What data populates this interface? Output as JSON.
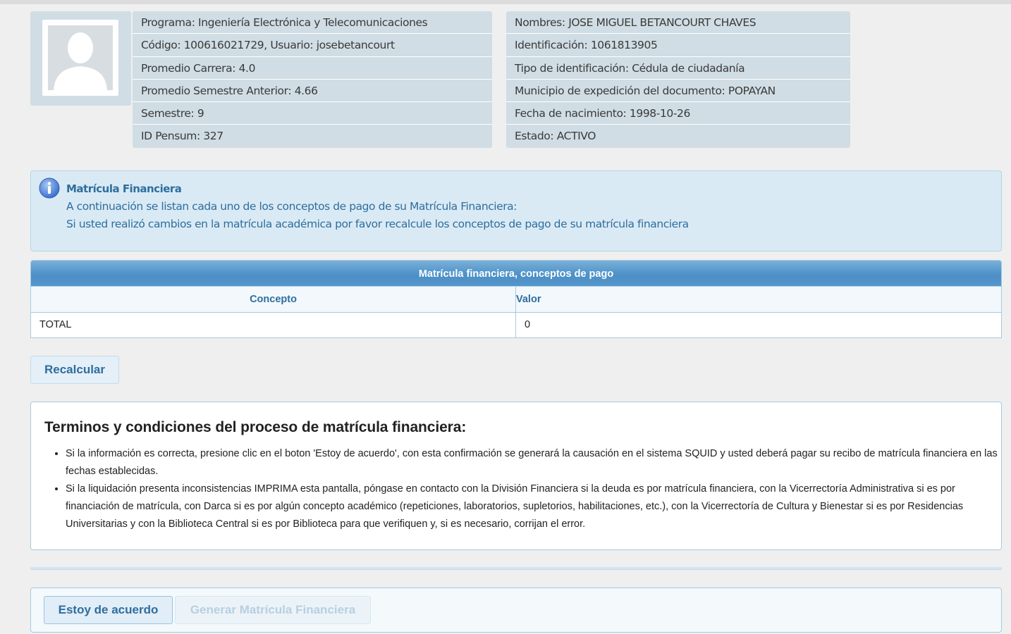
{
  "profile": {
    "left": [
      "Programa: Ingeniería Electrónica y Telecomunicaciones",
      "Código: 100616021729, Usuario: josebetancourt",
      "Promedio Carrera: 4.0",
      "Promedio Semestre Anterior: 4.66",
      "Semestre: 9",
      "ID Pensum: 327"
    ],
    "right": [
      "Nombres: JOSE MIGUEL BETANCOURT CHAVES",
      "Identificación: 1061813905",
      "Tipo de identificación: Cédula de ciudadanía",
      "Municipio de expedición del documento: POPAYAN",
      "Fecha de nacimiento: 1998-10-26",
      "Estado: ACTIVO"
    ]
  },
  "notice": {
    "icon": "info-icon",
    "title": "Matrícula Financiera",
    "line1": "A continuación se listan cada uno de los conceptos de pago de su Matrícula Financiera:",
    "line2": "Si usted realizó cambios en la matrícula académica por favor recalcule los conceptos de pago de su matrícula financiera"
  },
  "table": {
    "caption": "Matrícula financiera, conceptos de pago",
    "columns": [
      "Concepto",
      "Valor"
    ],
    "rows": [
      [
        "TOTAL",
        "0"
      ]
    ]
  },
  "buttons": {
    "recalc": "Recalcular",
    "agree": "Estoy de acuerdo",
    "generate": "Generar Matrícula Financiera"
  },
  "terms": {
    "title": "Terminos y condiciones del proceso de matrícula financiera:",
    "items": [
      "Si la información es correcta, presione clic en el boton 'Estoy de acuerdo', con esta confirmación se generará la causación en el sistema SQUID y usted deberá pagar su recibo de matrícula financiera en las fechas establecidas.",
      "Si la liquidación presenta inconsistencias IMPRIMA esta pantalla, póngase en contacto con la División Financiera si la deuda es por matrícula financiera, con la Vicerrectoría Administrativa si es por financiación de matrícula, con Darca si es por algún concepto académico (repeticiones, laboratorios, supletorios, habilitaciones, etc.), con la Vicerrectoría de Cultura y Bienestar si es por Residencias Universitarias y con la Biblioteca Central si es por Biblioteca para que verifiquen y, si es necesario, corrijan el error."
    ]
  }
}
